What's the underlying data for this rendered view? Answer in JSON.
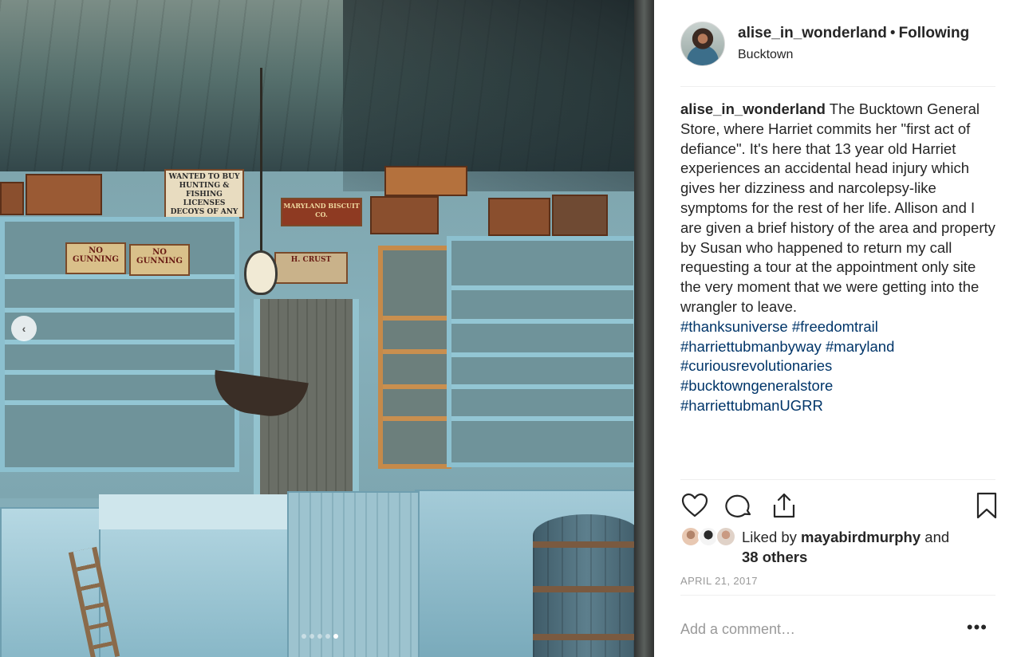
{
  "post": {
    "username": "alise_in_wonderland",
    "separator": "•",
    "follow_status": "Following",
    "location": "Bucktown"
  },
  "photo": {
    "signs": [
      "WANTED TO BUY HUNTING & FISHING LICENSES DECOYS OF ANY",
      "NO GUNNING",
      "NO GUNNING",
      "MARYLAND BISCUIT CO.",
      "H. CRUST"
    ],
    "carousel": {
      "prev_icon": "‹",
      "dot_count": 5,
      "active_index": 4
    }
  },
  "caption": {
    "user": "alise_in_wonderland",
    "text": "The Bucktown General Store, where Harriet commits her \"first act of defiance\". It's here that 13 year old Harriet experiences an accidental head injury which gives her dizziness and narcolepsy-like symptoms for the rest of her life. Allison and I are given a brief history of the area and property by Susan who happened to return my call requesting a tour at the appointment only site the very moment that we were getting into the wrangler to leave.",
    "hashtags": [
      "#thanksuniverse #freedomtrail",
      "#harriettubmanbyway #maryland",
      "#curiousrevolutionaries",
      "#bucktowngeneralstore",
      "#harriettubmanUGRR"
    ]
  },
  "actions": {
    "icons": [
      "heart-icon",
      "comment-icon",
      "share-icon",
      "bookmark-icon"
    ]
  },
  "likes": {
    "prefix": "Liked by",
    "user": "mayabirdmurphy",
    "conj": "and",
    "others": "38 others"
  },
  "date": "APRIL 21, 2017",
  "comment": {
    "placeholder": "Add a comment…",
    "more_icon": "•••"
  },
  "colors": {
    "hashtag": "#003569",
    "text": "#262626",
    "muted": "#999999",
    "divider": "#efefef"
  }
}
